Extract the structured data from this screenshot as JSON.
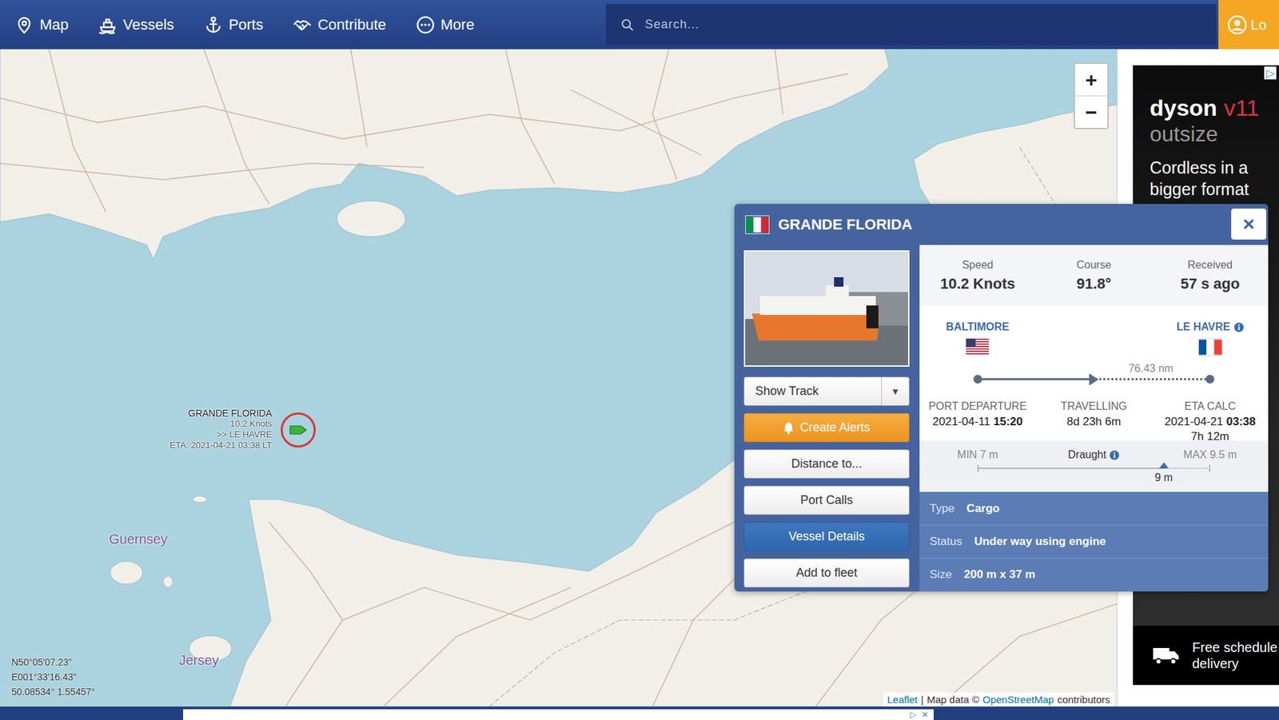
{
  "nav": {
    "items": [
      {
        "label": "Map"
      },
      {
        "label": "Vessels"
      },
      {
        "label": "Ports"
      },
      {
        "label": "Contribute"
      },
      {
        "label": "More"
      }
    ],
    "search_placeholder": "Search...",
    "login": "Lo"
  },
  "map": {
    "zoom_in": "+",
    "zoom_out": "−",
    "vessel_label": [
      "GRANDE FLORIDA",
      "10.2 Knots",
      ">> LE HAVRE",
      "ETA: 2021-04-21 03:38 LT"
    ],
    "vessel_selected": true,
    "places": [
      {
        "label": "Guernsey"
      },
      {
        "label": "Jersey"
      }
    ],
    "coords": [
      "N50°05'07.23\"",
      "E001°33'16.43\"",
      "50.08534° 1.55457°"
    ],
    "attribution": {
      "leaflet": "Leaflet",
      "sep": "|",
      "mapdata": "Map data ©",
      "osm": "OpenStreetMap",
      "rest": "contributors"
    }
  },
  "ad": {
    "choice": "▷",
    "brand": "dyson",
    "model": "v11",
    "line": "outsize",
    "copy": [
      "Cordless in a",
      "bigger format"
    ],
    "footer": [
      "Free schedule",
      "delivery"
    ]
  },
  "bottom_ad": {
    "icons": [
      "▷",
      "✕"
    ]
  },
  "popup": {
    "title": "GRANDE FLORIDA",
    "close": "×",
    "buttons": [
      {
        "label": "Show Track",
        "kind": "split",
        "caret": "▾"
      },
      {
        "label": "Create Alerts",
        "kind": "alert"
      },
      {
        "label": "Distance to...",
        "kind": "default"
      },
      {
        "label": "Port Calls",
        "kind": "default"
      },
      {
        "label": "Vessel Details",
        "kind": "primary"
      },
      {
        "label": "Add to fleet",
        "kind": "default"
      }
    ],
    "stats": [
      {
        "label": "Speed",
        "value": "10.2 Knots"
      },
      {
        "label": "Course",
        "value": "91.8°"
      },
      {
        "label": "Received",
        "value": "57 s ago"
      }
    ],
    "route": {
      "from": "BALTIMORE",
      "to": "LE HAVRE",
      "remaining": "76.43 nm",
      "level": 0.49,
      "departure": {
        "label": "PORT DEPARTURE",
        "date": "2021-04-11",
        "time": "15:20"
      },
      "travelling": {
        "label": "TRAVELLING",
        "value": "8d 23h 6m"
      },
      "eta": {
        "label": "ETA CALC",
        "date": "2021-04-21",
        "time": "03:38",
        "left": "7h 12m"
      }
    },
    "draught": {
      "min": "MIN 7 m",
      "label": "Draught",
      "max": "MAX 9.5 m",
      "value": "9 m",
      "level": 0.8
    },
    "details": [
      {
        "label": "Type",
        "value": "Cargo"
      },
      {
        "label": "Status",
        "value": "Under way using engine"
      },
      {
        "label": "Size",
        "value": "200 m x 37 m"
      }
    ]
  }
}
